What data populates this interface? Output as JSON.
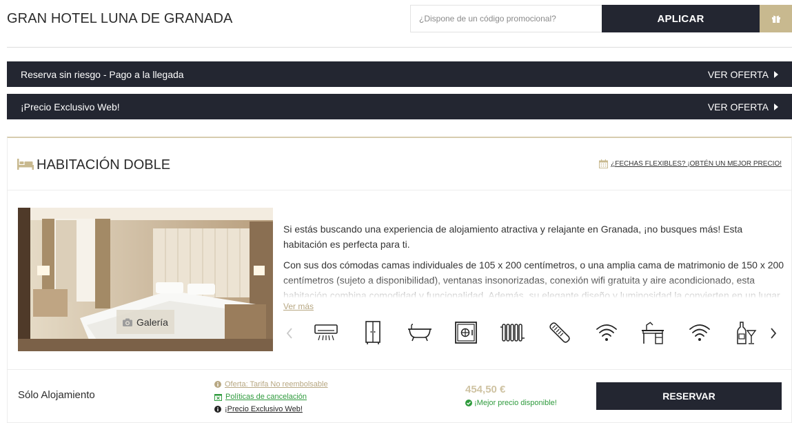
{
  "header": {
    "hotel_name": "GRAN HOTEL LUNA DE GRANADA",
    "promo_placeholder": "¿Dispone de un código promocional?",
    "apply_label": "APLICAR"
  },
  "offers": [
    {
      "label": "Reserva sin riesgo - Pago a la llegada",
      "cta": "VER OFERTA"
    },
    {
      "label": "¡Precio Exclusivo Web!",
      "cta": "VER OFERTA"
    }
  ],
  "room": {
    "title": "HABITACIÓN DOBLE",
    "flexible_dates": "¿FECHAS FLEXIBLES? ¡OBTÉN UN MEJOR PRECIO!",
    "gallery_label": "Galería",
    "description": [
      "Si estás buscando una experiencia de alojamiento atractiva y relajante en Granada, ¡no busques más! Esta habitación es perfecta para ti.",
      "Con sus dos cómodas camas individuales de 105 x 200 centímetros, o una amplia cama de matrimonio de 150 x 200 centímetros (sujeto a disponibilidad), ventanas insonorizadas, conexión wifi gratuita y aire acondicionado, esta habitación combina comodidad y funcionalidad. Además, su elegante diseño y luminosidad la convierten en un lugar"
    ],
    "see_more": "Ver más",
    "amenities": [
      "air-conditioning-icon",
      "wardrobe-icon",
      "bathtub-icon",
      "safe-icon",
      "heating-icon",
      "hairdryer-icon",
      "wifi-icon",
      "desk-icon",
      "wifi-icon",
      "minibar-icon"
    ]
  },
  "rate": {
    "name": "Sólo Alojamiento",
    "links": [
      {
        "label": "Oferta: Tarifa No reembolsable",
        "color": "#b7a782",
        "icon": "info-icon"
      },
      {
        "label": "Políticas de cancelación",
        "color": "#2e9a3c",
        "icon": "calendar-x-icon"
      },
      {
        "label": "¡Precio Exclusivo Web!",
        "color": "#222222",
        "icon": "info-icon"
      }
    ],
    "price": "454,50 €",
    "best_price": "¡Mejor precio disponible!",
    "reserve_label": "RESERVAR"
  },
  "colors": {
    "dark": "#232631",
    "gold": "#c8b98f",
    "green": "#2e9a3c"
  }
}
